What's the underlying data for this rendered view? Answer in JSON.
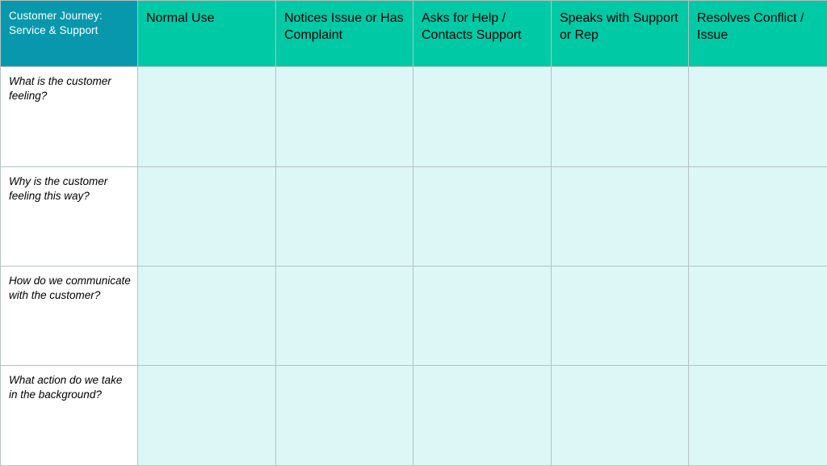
{
  "board": {
    "title": "Customer Journey: Service & Support",
    "title_line1": "Customer Journey:",
    "title_line2": "Service & Support",
    "colors": {
      "title_cell": "#0898ad",
      "stage_header": "#00c9a6",
      "body_cell": "#ddf7f6",
      "row_label_cell": "#ffffff",
      "grid_line": "#b4c2c2",
      "title_text": "#ffffff",
      "header_text": "#000000"
    }
  },
  "columns": [
    {
      "id": "stage-normal-use",
      "label": "Normal Use"
    },
    {
      "id": "stage-notices-issue",
      "label": "Notices Issue or Has Complaint"
    },
    {
      "id": "stage-asks-for-help",
      "label": "Asks for Help / Contacts Support"
    },
    {
      "id": "stage-speaks-with-support",
      "label": "Speaks with Support or Rep"
    },
    {
      "id": "stage-resolves-conflict",
      "label": "Resolves Conflict / Issue"
    }
  ],
  "rows": [
    {
      "id": "row-feeling",
      "label": "What is the customer feeling?",
      "cells": [
        "",
        "",
        "",
        "",
        ""
      ]
    },
    {
      "id": "row-why-feeling",
      "label": "Why is the customer feeling this way?",
      "cells": [
        "",
        "",
        "",
        "",
        ""
      ]
    },
    {
      "id": "row-communicate",
      "label": "How do we communicate with the customer?",
      "cells": [
        "",
        "",
        "",
        "",
        ""
      ]
    },
    {
      "id": "row-background-action",
      "label": "What action do we take in the background?",
      "cells": [
        "",
        "",
        "",
        "",
        ""
      ]
    }
  ]
}
